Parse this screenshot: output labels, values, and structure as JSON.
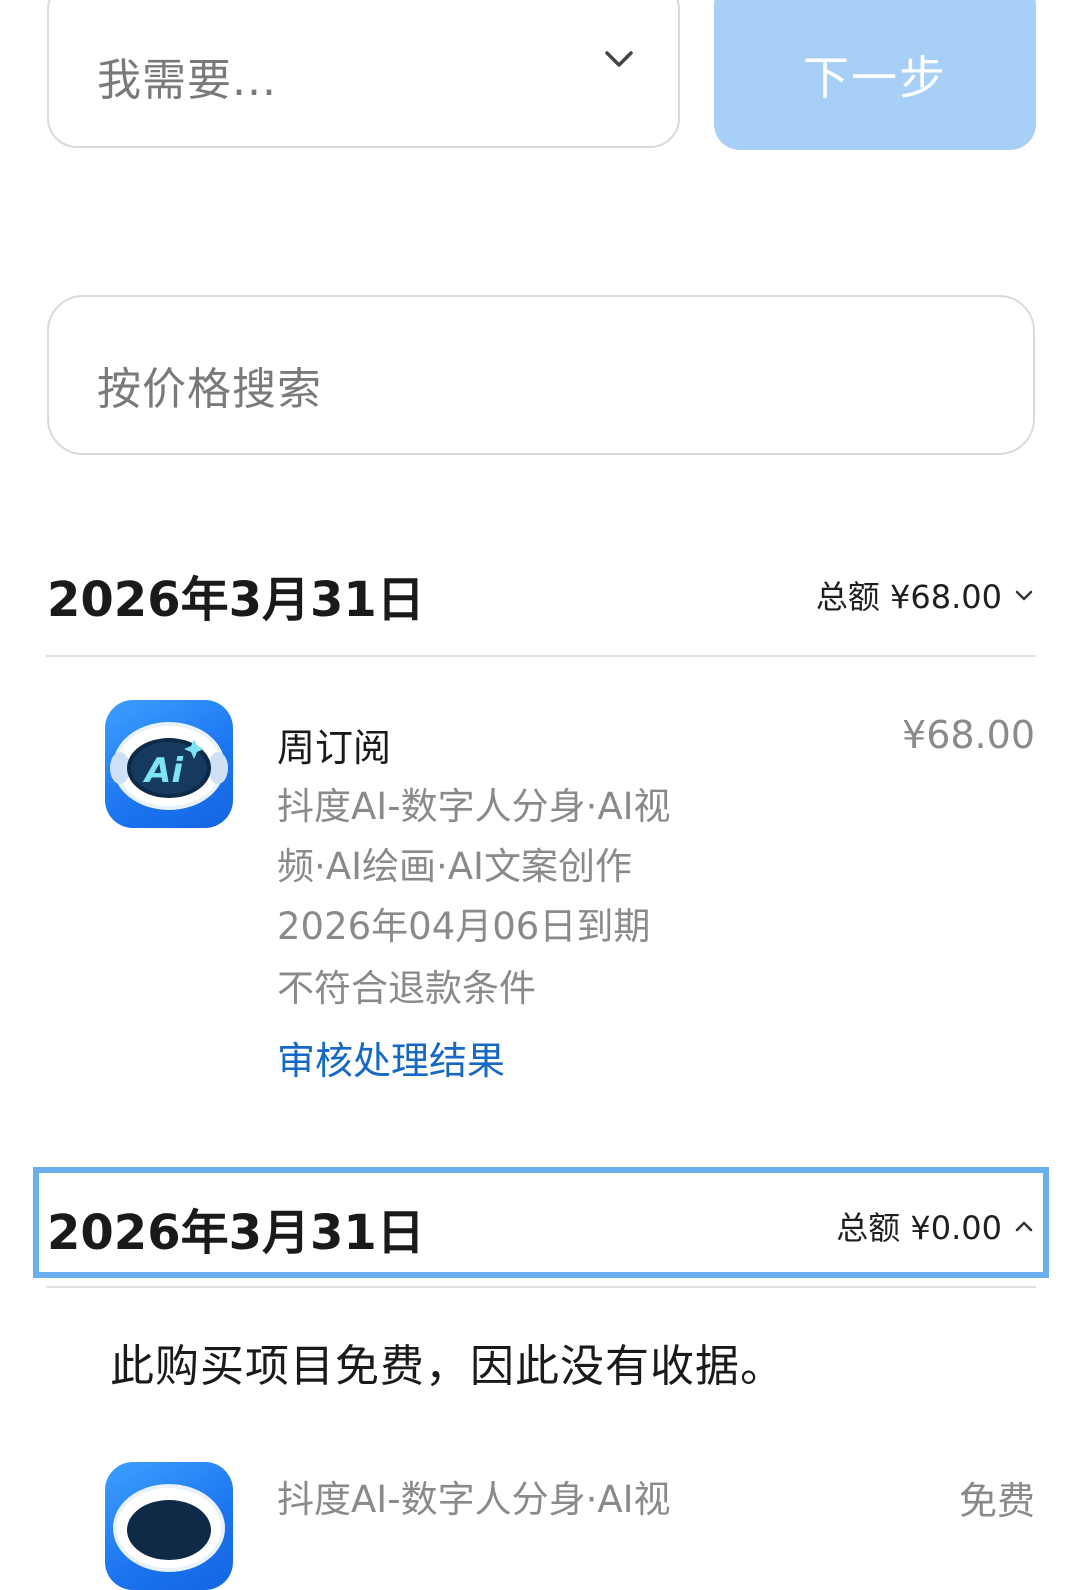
{
  "top": {
    "select_placeholder": "我需要...",
    "next_label": "下一步",
    "search_placeholder": "按价格搜索"
  },
  "sections": [
    {
      "date": "2026年3月31日",
      "total": "总额 ¥68.00",
      "item": {
        "title": "周订阅",
        "app_line1": "抖度AI-数字人分身·AI视",
        "app_line2": "频·AI绘画·AI文案创作",
        "expiry": "2026年04月06日到期",
        "refund_status": "不符合退款条件",
        "link": "审核处理结果",
        "price": "¥68.00",
        "icon_text": "Ai"
      }
    },
    {
      "date": "2026年3月31日",
      "total": "总额 ¥0.00",
      "note": "此购买项目免费，因此没有收据。",
      "item": {
        "app_line1": "抖度AI-数字人分身·AI视",
        "price": "免费"
      }
    }
  ],
  "colors": {
    "accent_link": "#1568c4",
    "next_button": "#a8cff5",
    "focus_frame": "#6aaef0"
  }
}
